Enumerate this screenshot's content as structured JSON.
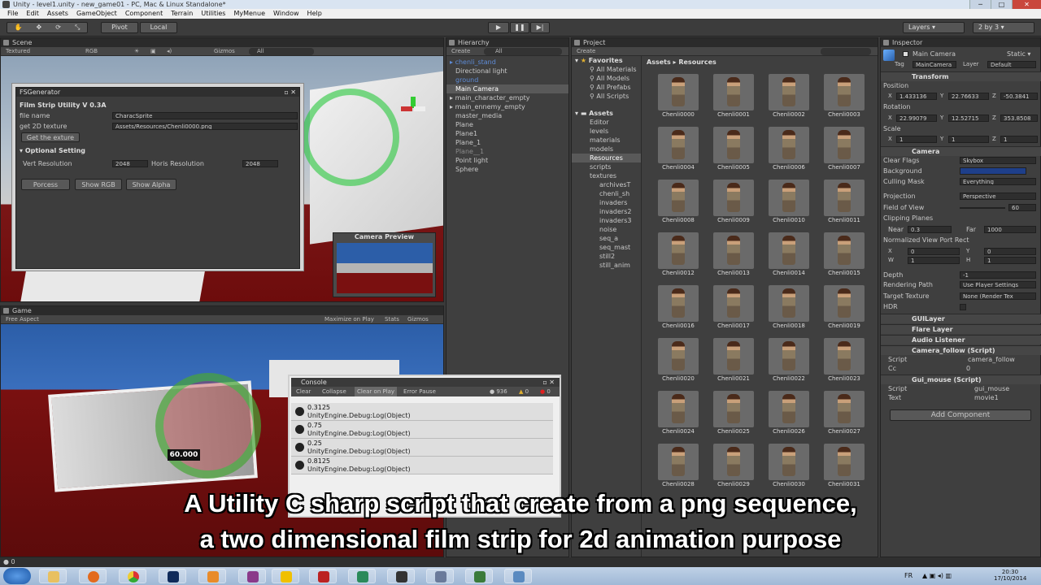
{
  "window": {
    "title": "Unity - level1.unity - new_game01 - PC, Mac & Linux Standalone*"
  },
  "menu": [
    "File",
    "Edit",
    "Assets",
    "GameObject",
    "Component",
    "Terrain",
    "Utilities",
    "MyMenue",
    "Window",
    "Help"
  ],
  "toolbar": {
    "pivot": "Pivot",
    "local": "Local",
    "layers": "Layers",
    "layout": "2 by 3"
  },
  "scene": {
    "tab": "Scene",
    "shading": "Textured",
    "rgb": "RGB",
    "gizmos": "Gizmos",
    "search": "All"
  },
  "fsgen": {
    "title": "FSGenerator",
    "heading": "Film Strip Utility V 0.3A",
    "file_name_label": "file name",
    "file_name_value": "CharacSprite",
    "texture_label": "get 2D texture",
    "texture_value": "Assets/Resources/Chenli0000.png",
    "get_texture_btn": "Get the exture",
    "optional": "Optional Setting",
    "vert_label": "Vert Resolution",
    "vert_value": "2048",
    "horis_label": "Horis Resolution",
    "horis_value": "2048",
    "process_btn": "Porcess",
    "rgb_btn": "Show RGB",
    "alpha_btn": "Show Alpha"
  },
  "camera_preview": "Camera Preview",
  "game": {
    "tab": "Game",
    "aspect": "Free Aspect",
    "maximize": "Maximize on Play",
    "stats": "Stats",
    "gizmos": "Gizmos",
    "score": "60.000"
  },
  "hierarchy": {
    "tab": "Hierarchy",
    "create": "Create",
    "search": "All",
    "items": [
      "chenli_stand",
      "Directional light",
      "ground",
      "Main Camera",
      "main_character_empty",
      "main_ennemy_empty",
      "master_media",
      "Plane",
      "Plane1",
      "Plane_1",
      "Plane__1",
      "Point light",
      "Sphere"
    ]
  },
  "project": {
    "tab": "Project",
    "create": "Create",
    "favorites": "Favorites",
    "fav_items": [
      "All Materials",
      "All Models",
      "All Prefabs",
      "All Scripts"
    ],
    "assets": "Assets",
    "folders": [
      "Editor",
      "levels",
      "materials",
      "models",
      "Resources",
      "scripts",
      "textures",
      "archivesT",
      "chenli_sh",
      "invaders",
      "invaders2",
      "invaders3",
      "noise",
      "seq_a",
      "seq_mast",
      "still2",
      "still_anim"
    ],
    "breadcrumb_root": "Assets",
    "breadcrumb_sep": "▸",
    "breadcrumb_current": "Resources",
    "thumbs": [
      "Chenli0000",
      "Chenli0001",
      "Chenli0002",
      "Chenli0003",
      "Chenli0004",
      "Chenli0005",
      "Chenli0006",
      "Chenli0007",
      "Chenli0008",
      "Chenli0009",
      "Chenli0010",
      "Chenli0011",
      "Chenli0012",
      "Chenli0013",
      "Chenli0014",
      "Chenli0015",
      "Chenli0016",
      "Chenli0017",
      "Chenli0018",
      "Chenli0019",
      "Chenli0020",
      "Chenli0021",
      "Chenli0022",
      "Chenli0023",
      "Chenli0024",
      "Chenli0025",
      "Chenli0026",
      "Chenli0027",
      "Chenli0028",
      "Chenli0029",
      "Chenli0030",
      "Chenli0031"
    ]
  },
  "inspector": {
    "tab": "Inspector",
    "object": "Main Camera",
    "static": "Static",
    "tag_label": "Tag",
    "tag": "MainCamera",
    "layer_label": "Layer",
    "layer": "Default",
    "transform": "Transform",
    "position": "Position",
    "pos": [
      "1.433136",
      "22.76633",
      "-50.3841"
    ],
    "rotation": "Rotation",
    "rot": [
      "22.99079",
      "12.52715",
      "353.8508"
    ],
    "scale": "Scale",
    "scl": [
      "1",
      "1",
      "1"
    ],
    "camera": "Camera",
    "clear_flags": "Clear Flags",
    "clear_flags_v": "Skybox",
    "background": "Background",
    "culling": "Culling Mask",
    "culling_v": "Everything",
    "projection": "Projection",
    "projection_v": "Perspective",
    "fov": "Field of View",
    "fov_v": "60",
    "clipping": "Clipping Planes",
    "near": "Near",
    "near_v": "0.3",
    "far": "Far",
    "far_v": "1000",
    "viewport": "Normalized View Port Rect",
    "vx": "0",
    "vy": "0",
    "vw": "1",
    "vh": "1",
    "depth": "Depth",
    "depth_v": "-1",
    "render_path": "Rendering Path",
    "render_path_v": "Use Player Settings",
    "target_tex": "Target Texture",
    "target_tex_v": "None (Render Tex",
    "hdr": "HDR",
    "components": [
      "GUILayer",
      "Flare Layer",
      "Audio Listener",
      "Camera_follow (Script)",
      "Gui_mouse (Script)"
    ],
    "script_label": "Script",
    "script1": "camera_follow",
    "cc": "Cc",
    "cc_v": "0",
    "script2": "gui_mouse",
    "text_label": "Text",
    "text_v": "movie1",
    "add_component": "Add Component"
  },
  "console": {
    "title": "Console",
    "clear": "Clear",
    "collapse": "Collapse",
    "clear_on_play": "Clear on Play",
    "error_pause": "Error Pause",
    "count_log": "936",
    "count_warn": "0",
    "count_err": "0",
    "rows": [
      {
        "v": "0.3125",
        "d": "UnityEngine.Debug:Log(Object)"
      },
      {
        "v": "0.75",
        "d": "UnityEngine.Debug:Log(Object)"
      },
      {
        "v": "0.25",
        "d": "UnityEngine.Debug:Log(Object)"
      },
      {
        "v": "0.8125",
        "d": "UnityEngine.Debug:Log(Object)"
      }
    ]
  },
  "status": {
    "text": "0"
  },
  "subtitle": {
    "line1": "A Utility C sharp script that create from a png sequence,",
    "line2": "a two dimensional film strip for 2d animation purpose"
  },
  "taskbar": {
    "lang": "FR",
    "time": "20:30",
    "date": "17/10/2014"
  }
}
